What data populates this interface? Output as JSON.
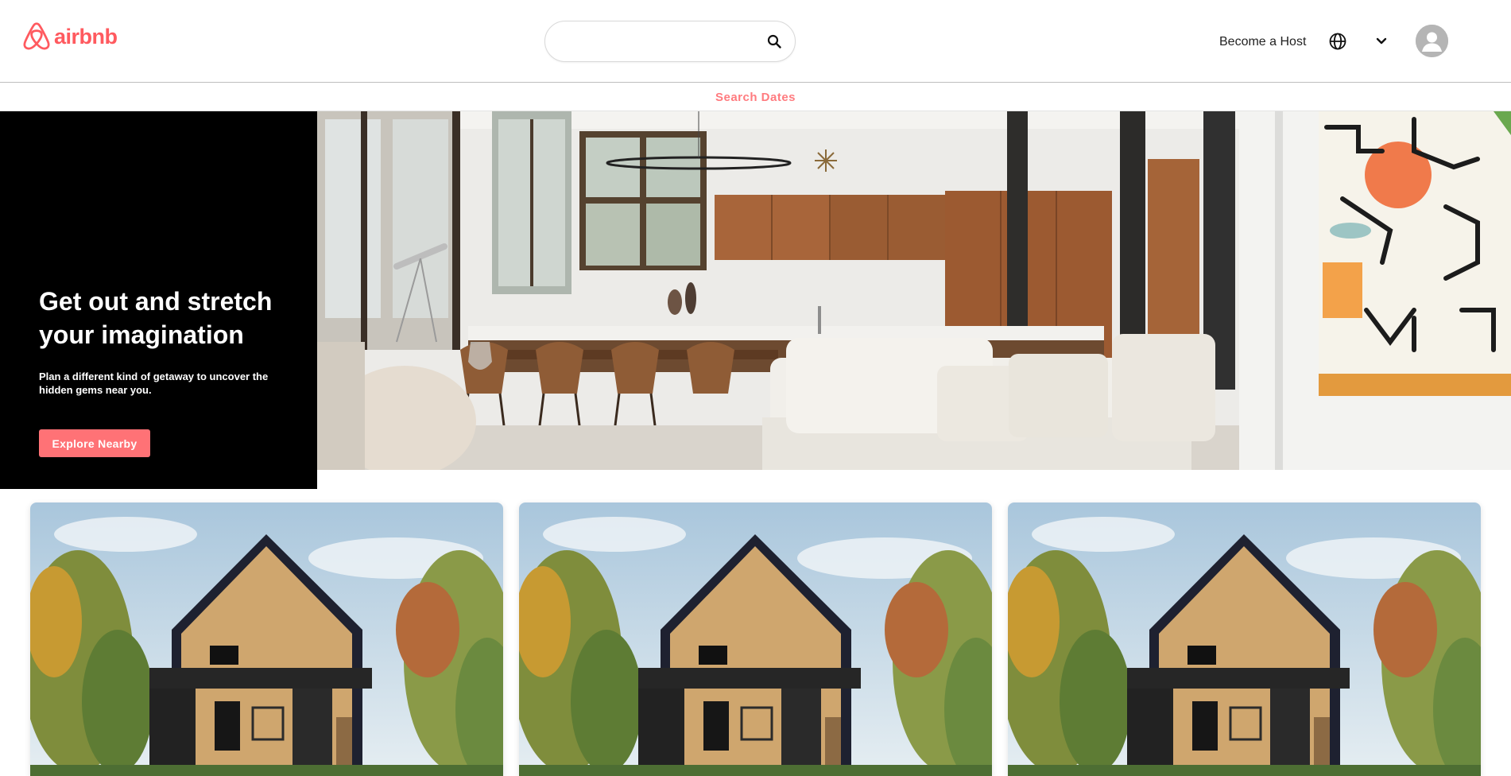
{
  "brand": {
    "name": "airbnb",
    "color": "#ff5a5f",
    "logo_icon": "airbnb-belo-icon"
  },
  "header": {
    "search": {
      "placeholder": "",
      "value": "",
      "icon": "search-icon"
    },
    "become_host_label": "Become a Host",
    "language_icon": "globe-icon",
    "menu_icon": "chevron-down-icon",
    "avatar_icon": "user-avatar-icon"
  },
  "dates_bar": {
    "label": "Search Dates",
    "color": "#ff7b7f"
  },
  "hero": {
    "title": "Get out and stretch your imagination",
    "subtitle": "Plan a different kind of getaway to uncover the hidden gems near you.",
    "button_label": "Explore Nearby",
    "button_color": "#ff7276",
    "image": "modern-living-room-kitchen-photo"
  },
  "cards": [
    {
      "image": "a-frame-cabin-photo"
    },
    {
      "image": "a-frame-cabin-photo"
    },
    {
      "image": "a-frame-cabin-photo"
    }
  ]
}
